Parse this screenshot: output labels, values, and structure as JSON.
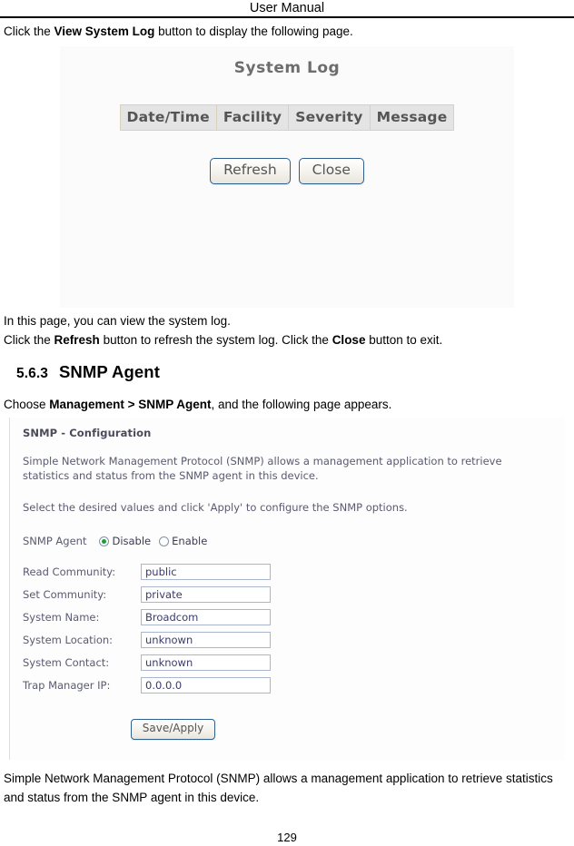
{
  "document": {
    "running_head": "User Manual",
    "page_number": "129"
  },
  "intro": {
    "line1_pre": "Click the ",
    "line1_bold": "View System Log",
    "line1_post": " button to display the following page."
  },
  "syslog_screenshot": {
    "title": "System Log",
    "table": {
      "columns": [
        "Date/Time",
        "Facility",
        "Severity",
        "Message"
      ],
      "rows": []
    },
    "buttons": [
      {
        "label": "Refresh",
        "name": "refresh-button"
      },
      {
        "label": "Close",
        "name": "close-button"
      }
    ]
  },
  "after_syslog": {
    "line1": "In this page, you can view the system log.",
    "line2_a": "Click the ",
    "line2_b": "Refresh",
    "line2_c": " button to refresh the system log. Click the ",
    "line2_d": "Close",
    "line2_e": " button to exit."
  },
  "section": {
    "number": "5.6.3",
    "title": "SNMP Agent",
    "choose_pre": "Choose ",
    "choose_bold": "Management > SNMP Agent",
    "choose_post": ", and the following page appears."
  },
  "snmp_screenshot": {
    "panel_title": "SNMP - Configuration",
    "paragraph1": "Simple Network Management Protocol (SNMP) allows a management application to retrieve statistics and status from the SNMP agent in this device.",
    "paragraph2": "Select the desired values and click 'Apply' to configure the SNMP options.",
    "agent_label": "SNMP Agent",
    "agent_options": [
      {
        "label": "Disable",
        "selected": true
      },
      {
        "label": "Enable",
        "selected": false
      }
    ],
    "fields": [
      {
        "label": "Read Community:",
        "value": "public"
      },
      {
        "label": "Set Community:",
        "value": "private"
      },
      {
        "label": "System Name:",
        "value": "Broadcom"
      },
      {
        "label": "System Location:",
        "value": "unknown"
      },
      {
        "label": "System Contact:",
        "value": "unknown"
      },
      {
        "label": "Trap Manager IP:",
        "value": "0.0.0.0"
      }
    ],
    "apply_button": "Save/Apply"
  },
  "closing": {
    "text": "Simple Network Management Protocol (SNMP) allows a management application to retrieve statistics and status from the SNMP agent in this device."
  },
  "colors": {
    "button_border": "#2f5f8f",
    "radio_selected": "#1f9d3a",
    "input_border": "#a9b6cb",
    "panel_text": "#5a5a70"
  }
}
